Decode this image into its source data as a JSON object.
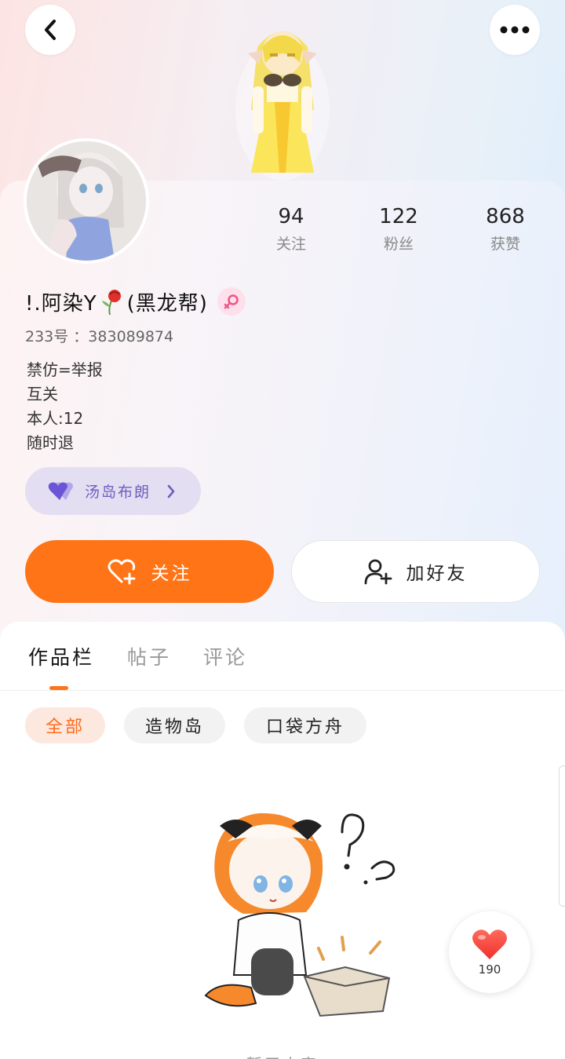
{
  "header": {
    "back_icon": "chevron-left-icon",
    "more_icon": "more-dots-icon"
  },
  "stats": [
    {
      "value": "94",
      "label": "关注"
    },
    {
      "value": "122",
      "label": "粉丝"
    },
    {
      "value": "868",
      "label": "获赞"
    }
  ],
  "profile": {
    "name_prefix": "!.阿染Y",
    "name_suffix": "(黑龙帮)",
    "gender_icon": "female-icon",
    "uid": "233号 ：383089874",
    "bio_lines": [
      "禁仿=举报",
      "互关",
      "本人:12",
      "随时退"
    ]
  },
  "club": {
    "icon": "double-heart-icon",
    "label": "汤岛布朗"
  },
  "actions": {
    "follow_label": "关注",
    "add_friend_label": "加好友"
  },
  "tabs": [
    "作品栏",
    "帖子",
    "评论"
  ],
  "filters": [
    "全部",
    "造物岛",
    "口袋方舟"
  ],
  "empty": {
    "text": "暂无内容"
  },
  "like": {
    "count": "190"
  },
  "colors": {
    "accent": "#ff7417",
    "club": "#6f5fbf",
    "chip_active_bg": "#fde8df"
  }
}
